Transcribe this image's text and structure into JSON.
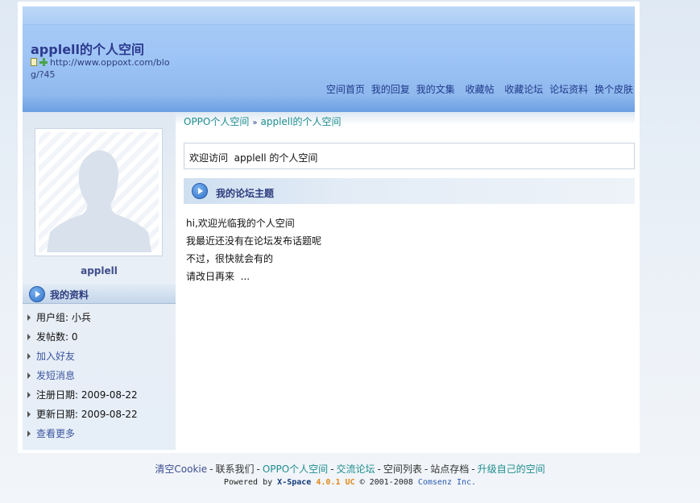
{
  "header": {
    "title": "applell的个人空间",
    "url": "http://www.oppoxt.com/blog/?45",
    "nav": [
      "空间首页",
      "我的回复",
      "我的文集",
      "收藏帖",
      "收藏论坛",
      "论坛资料",
      "换个皮肤"
    ]
  },
  "breadcrumb": [
    "OPPO个人空间",
    "applell的个人空间"
  ],
  "breadcrumb_sep": "»",
  "sidebar": {
    "username": "applell",
    "profile_title": "我的资料",
    "items": [
      {
        "label": "用户组: 小兵",
        "link": false
      },
      {
        "label": "发帖数: 0",
        "link": false
      },
      {
        "label": "加入好友",
        "link": true
      },
      {
        "label": "发短消息",
        "link": true
      },
      {
        "label": "注册日期: 2009-08-22",
        "link": false
      },
      {
        "label": "更新日期: 2009-08-22",
        "link": false
      },
      {
        "label": "查看更多",
        "link": true
      }
    ]
  },
  "main": {
    "welcome": "欢迎访问  applell 的个人空间",
    "threads_title": "我的论坛主题",
    "empty_lines": [
      "hi,欢迎光临我的个人空间",
      "我最近还没有在论坛发布话题呢",
      "不过，很快就会有的",
      "请改日再来  ..."
    ]
  },
  "footer": {
    "links": [
      "清空Cookie",
      "联系我们",
      "OPPO个人空间",
      "交流论坛",
      "空间列表",
      "站点存档",
      "升级自己的空间"
    ],
    "separator": "-",
    "powered_prefix": "Powered by",
    "product": "X-Space",
    "version": "4.0.1 UC",
    "copyright": "© 2001-2008",
    "company": "Comsenz Inc."
  },
  "colors": {
    "header_blue": "#9fc5f6",
    "title_navy": "#2d3a8e",
    "link_teal": "#1e8e8e",
    "version_orange": "#e0891a"
  }
}
